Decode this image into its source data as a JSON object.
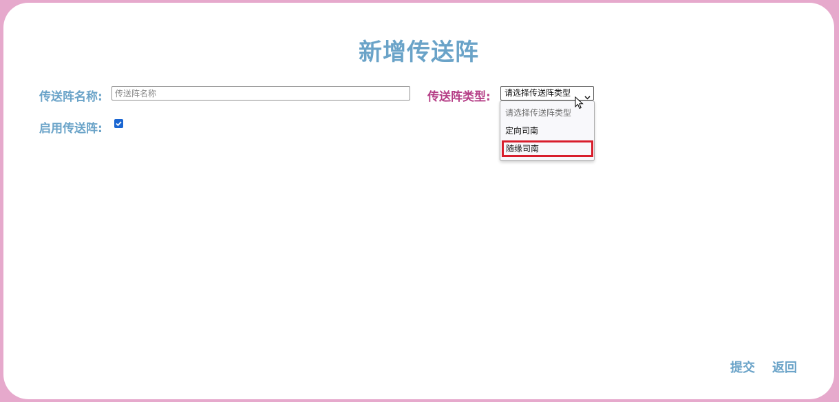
{
  "page": {
    "title": "新增传送阵"
  },
  "form": {
    "name_label": "传送阵名称:",
    "name_value": "",
    "name_placeholder": "传送阵名称",
    "type_label": "传送阵类型:",
    "type_selected": "请选择传送阵类型",
    "type_options": [
      "请选择传送阵类型",
      "定向司南",
      "随缘司南"
    ],
    "type_highlighted_option": "随缘司南",
    "enable_label": "启用传送阵:",
    "enable_checked": true
  },
  "actions": {
    "submit_label": "提交",
    "back_label": "返回"
  },
  "colors": {
    "background_frame": "#e6a9cc",
    "title_blue": "#6aa3c8",
    "type_label_magenta": "#b53d86",
    "highlight_red": "#d81e2c",
    "checkbox_blue": "#1a66d2"
  }
}
